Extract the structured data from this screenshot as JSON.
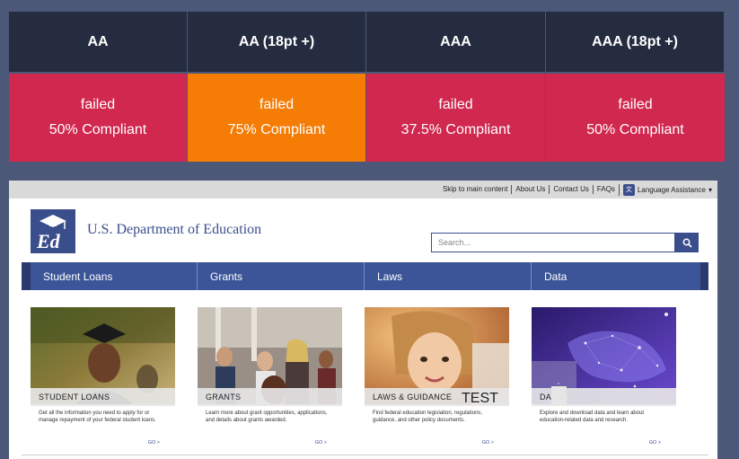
{
  "compliance": {
    "headers": [
      "AA",
      "AA (18pt +)",
      "AAA",
      "AAA (18pt +)"
    ],
    "cells": [
      {
        "status": "failed",
        "percent": "50% Compliant",
        "color": "#d0284e"
      },
      {
        "status": "failed",
        "percent": "75% Compliant",
        "color": "#f57c05"
      },
      {
        "status": "failed",
        "percent": "37.5% Compliant",
        "color": "#d0284e"
      },
      {
        "status": "failed",
        "percent": "50% Compliant",
        "color": "#d0284e"
      }
    ]
  },
  "site": {
    "utility_links": [
      "Skip to main content",
      "About Us",
      "Contact Us",
      "FAQs"
    ],
    "language_label": "Language Assistance",
    "brand_name": "U.S. Department of Education",
    "search_placeholder": "Search...",
    "nav": [
      "Student Loans",
      "Grants",
      "Laws",
      "Data"
    ],
    "cards": [
      {
        "title": "STUDENT LOANS",
        "text": "Get all the information you need to apply for or manage repayment of your federal student loans.",
        "go": "GO >"
      },
      {
        "title": "GRANTS",
        "text": "Learn more about grant opportunities, applications, and details about grants awarded.",
        "go": "GO >"
      },
      {
        "title": "LAWS & GUIDANCE",
        "text": "Find federal education legislation, regulations, guidance, and other policy documents.",
        "go": "GO >"
      },
      {
        "title": "DA",
        "text": "Explore and download data and learn about education-related data and research.",
        "go": "GO >"
      }
    ],
    "overlay_label": "TEST"
  }
}
